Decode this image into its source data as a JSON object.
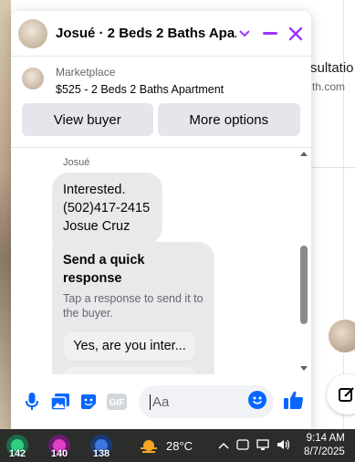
{
  "background": {
    "right_text_line1": "sultatio",
    "right_text_line2": "th.com"
  },
  "chat": {
    "title": "Josué · 2 Beds 2 Baths Apa...",
    "colors": {
      "accent": "#a033ff",
      "blue": "#0866ff"
    },
    "marketplace": {
      "label": "Marketplace",
      "listing": "$525 - 2 Beds 2 Baths Apartment",
      "view_buyer_label": "View buyer",
      "more_options_label": "More options"
    },
    "messages": {
      "sender": "Josué",
      "bubble_lines": [
        "Interested.",
        "(502)417-2415",
        "Josue Cruz"
      ],
      "quick_response": {
        "title": "Send a quick response",
        "subtitle": "Tap a response to send it to the buyer.",
        "option1": "Yes, are you inter..."
      }
    },
    "composer": {
      "placeholder": "Aa",
      "icons": [
        "microphone-icon",
        "image-icon",
        "sticker-icon",
        "gif-icon",
        "emoji-icon",
        "thumbs-up-icon"
      ],
      "gif_label": "GIF"
    }
  },
  "taskbar": {
    "app_badges": [
      "142",
      "140",
      "138"
    ],
    "temperature": "28°C",
    "time": "9:14 AM",
    "date": "8/7/2025"
  }
}
